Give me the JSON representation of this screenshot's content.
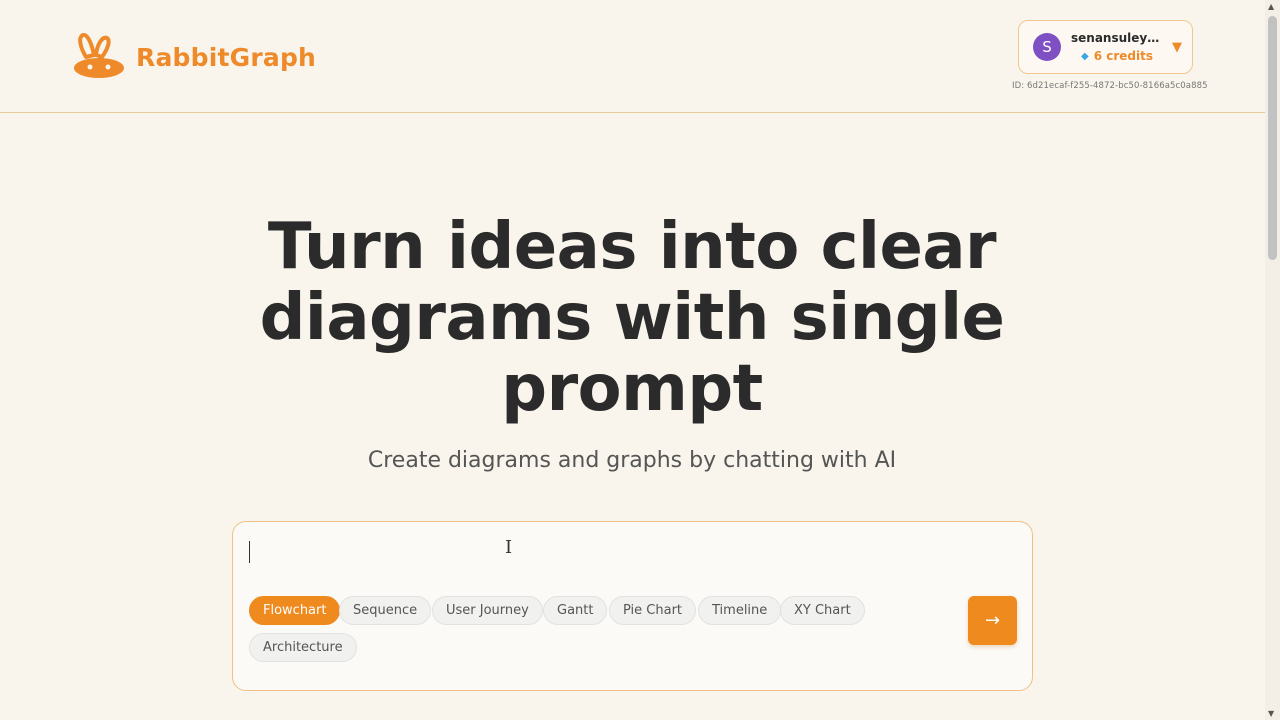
{
  "brand": {
    "name": "RabbitGraph",
    "color": "#ee8a2a"
  },
  "user": {
    "avatar_letter": "S",
    "name": "senansuleym...",
    "credits": "6 credits",
    "id": "ID: 6d21ecaf-f255-4872-bc50-8166a5c0a885"
  },
  "icons": {
    "logo": "rabbit-icon",
    "credits": "gem-icon",
    "dropdown": "caret-down-icon",
    "send": "arrow-right-icon",
    "cursor": "ibeam-cursor-icon"
  },
  "hero": {
    "title": "Turn ideas into clear diagrams with single prompt",
    "subtitle": "Create diagrams and graphs by chatting with AI"
  },
  "prompt": {
    "value": "",
    "placeholder": "",
    "send_label": "→",
    "chips": [
      {
        "label": "Flowchart",
        "active": true
      },
      {
        "label": "Sequence",
        "active": false
      },
      {
        "label": "User Journey",
        "active": false
      },
      {
        "label": "Gantt",
        "active": false
      },
      {
        "label": "Pie Chart",
        "active": false
      },
      {
        "label": "Timeline",
        "active": false
      },
      {
        "label": "XY Chart",
        "active": false
      },
      {
        "label": "Architecture",
        "active": false
      }
    ]
  },
  "colors": {
    "background": "#f9f5ec",
    "accent": "#ef8a1f",
    "avatar": "#7f4fc4"
  }
}
